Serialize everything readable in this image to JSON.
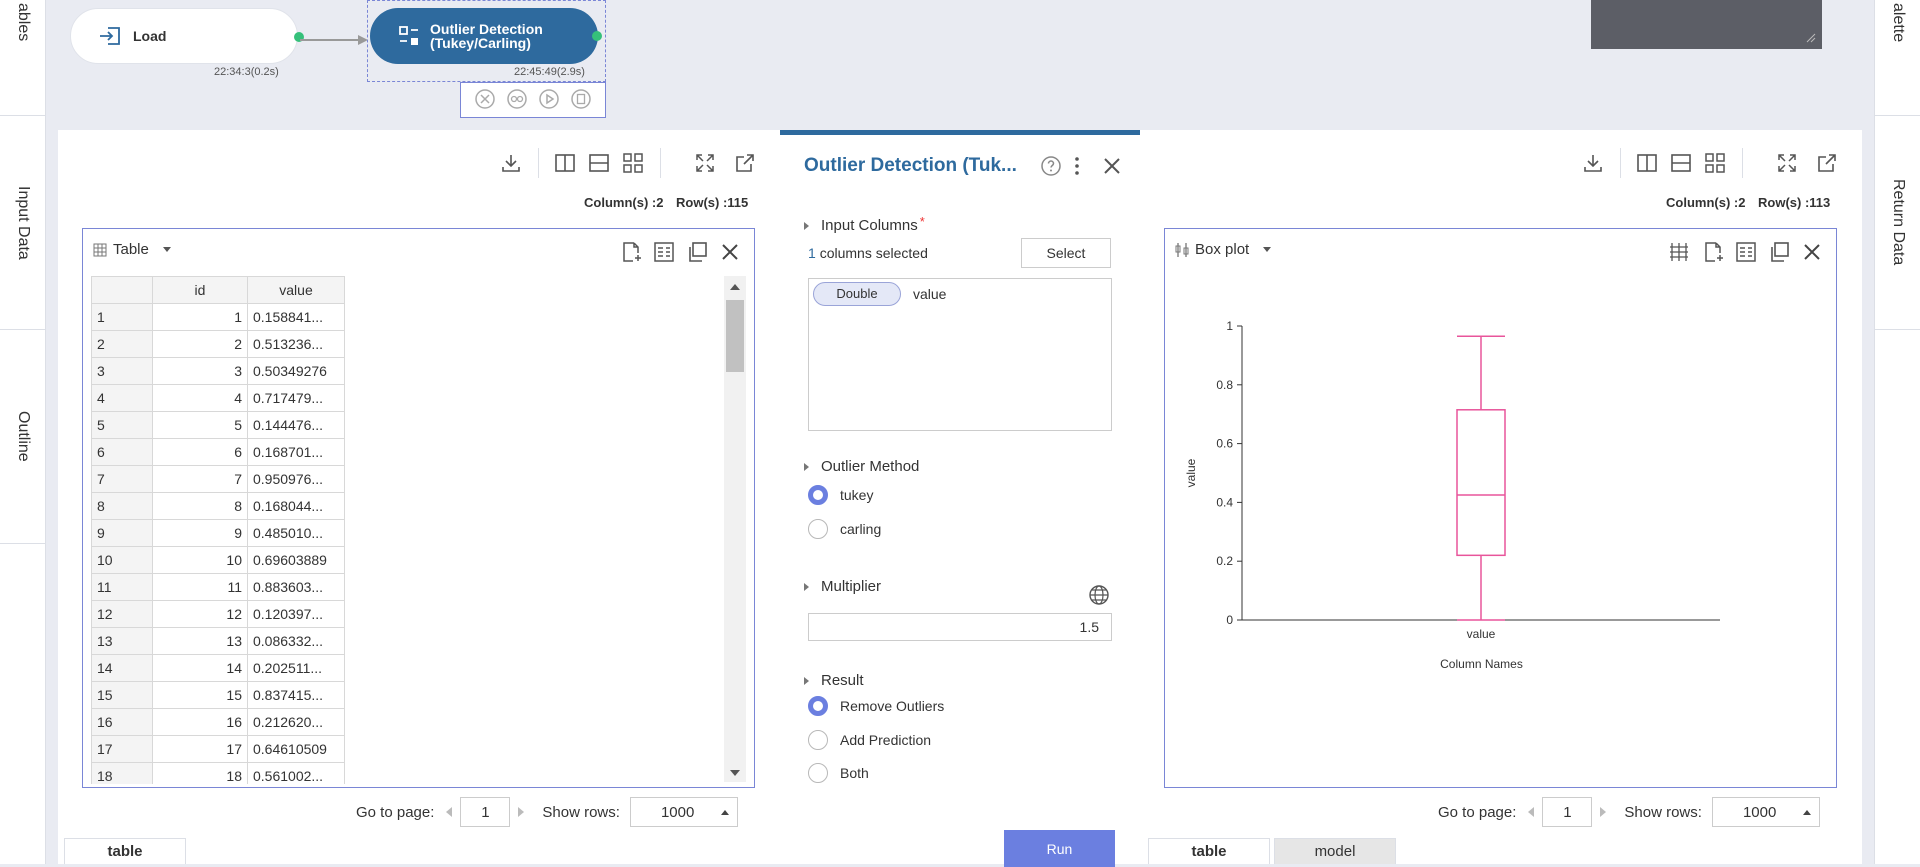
{
  "rails": {
    "left": [
      "ables",
      "Input Data",
      "Outline"
    ],
    "right": [
      "alette",
      "Return Data"
    ]
  },
  "canvas": {
    "load_node": {
      "label": "Load",
      "time": "22:34:3(0.2s)"
    },
    "od_node": {
      "label_line1": "Outlier Detection",
      "label_line2": "(Tukey/Carling)",
      "time": "22:45:49(2.9s)"
    }
  },
  "input_panel": {
    "columns_info": "Column(s) :2",
    "rows_info": "Row(s) :115",
    "view_type": "Table",
    "headers": [
      "id",
      "value"
    ],
    "rows": [
      [
        "1",
        "1",
        "0.158841..."
      ],
      [
        "2",
        "2",
        "0.513236..."
      ],
      [
        "3",
        "3",
        "0.50349276"
      ],
      [
        "4",
        "4",
        "0.717479..."
      ],
      [
        "5",
        "5",
        "0.144476..."
      ],
      [
        "6",
        "6",
        "0.168701..."
      ],
      [
        "7",
        "7",
        "0.950976..."
      ],
      [
        "8",
        "8",
        "0.168044..."
      ],
      [
        "9",
        "9",
        "0.485010..."
      ],
      [
        "10",
        "10",
        "0.69603889"
      ],
      [
        "11",
        "11",
        "0.883603..."
      ],
      [
        "12",
        "12",
        "0.120397..."
      ],
      [
        "13",
        "13",
        "0.086332..."
      ],
      [
        "14",
        "14",
        "0.202511..."
      ],
      [
        "15",
        "15",
        "0.837415..."
      ],
      [
        "16",
        "16",
        "0.212620..."
      ],
      [
        "17",
        "17",
        "0.64610509"
      ],
      [
        "18",
        "18",
        "0.561002..."
      ]
    ],
    "go_to_page_label": "Go to page:",
    "page": "1",
    "show_rows_label": "Show rows:",
    "show_rows": "1000",
    "bottom_tab": "table"
  },
  "settings": {
    "title": "Outlier Detection (Tuk...",
    "input_columns_label": "Input Columns",
    "required_mark": "*",
    "selected_count": "1",
    "selected_text": "columns selected",
    "select_button": "Select",
    "column_type": "Double",
    "column_name": "value",
    "outlier_method_label": "Outlier Method",
    "methods": [
      "tukey",
      "carling"
    ],
    "selected_method": "tukey",
    "multiplier_label": "Multiplier",
    "multiplier_value": "1.5",
    "result_label": "Result",
    "results": [
      "Remove Outliers",
      "Add Prediction",
      "Both"
    ],
    "selected_result": "Remove Outliers",
    "run_button": "Run"
  },
  "output_panel": {
    "columns_info": "Column(s) :2",
    "rows_info": "Row(s) :113",
    "view_type": "Box plot",
    "go_to_page_label": "Go to page:",
    "page": "1",
    "show_rows_label": "Show rows:",
    "show_rows": "1000",
    "tabs": [
      "table",
      "model"
    ]
  },
  "chart_data": {
    "type": "box",
    "categories": [
      "value"
    ],
    "boxes": [
      {
        "min": 0.0,
        "q1": 0.22,
        "median": 0.425,
        "q3": 0.715,
        "max": 0.965
      }
    ],
    "ylabel": "value",
    "xlabel": "Column Names",
    "ylim": [
      0,
      1
    ],
    "yticks": [
      "0",
      "0.2",
      "0.4",
      "0.6",
      "0.8",
      "1"
    ],
    "color": "#e8559b"
  },
  "colors": {
    "accent": "#6b7fe0",
    "node": "#2e6a9e",
    "title": "#2e6a9e",
    "port": "#35c07a"
  }
}
